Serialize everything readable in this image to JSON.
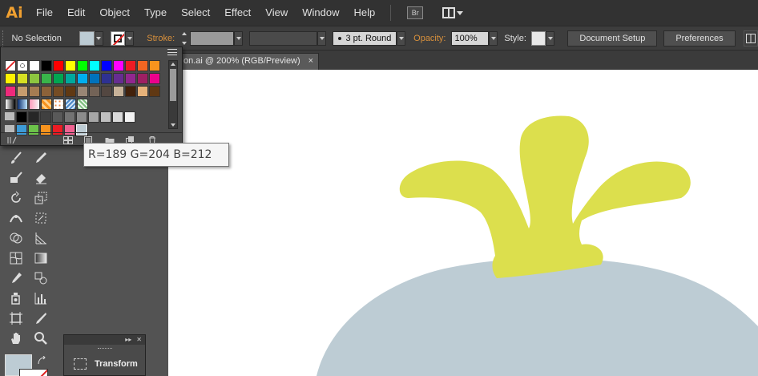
{
  "app": {
    "logo": "Ai"
  },
  "menu": {
    "items": [
      "File",
      "Edit",
      "Object",
      "Type",
      "Select",
      "Effect",
      "View",
      "Window",
      "Help"
    ],
    "bridge_label": "Br"
  },
  "control_bar": {
    "selection": "No Selection",
    "fill_color": "#bdccd4",
    "stroke_label": "Stroke:",
    "stroke_weight": "",
    "brush_profile": "3 pt. Round",
    "opacity_label": "Opacity:",
    "opacity_value": "100%",
    "style_label": "Style:",
    "document_setup": "Document Setup",
    "preferences": "Preferences"
  },
  "document": {
    "tab_title": "on.ai @ 200% (RGB/Preview)",
    "close": "×"
  },
  "swatch_panel": {
    "rows": [
      [
        "none",
        "registration",
        "#ffffff",
        "#000000",
        "#ff0000",
        "#ffff00",
        "#00ff00",
        "#00ffff",
        "#0000ff",
        "#ff00ff",
        "#ed1c24",
        "#f26522",
        "#f7941d"
      ],
      [
        "#fff200",
        "#d7df23",
        "#8dc63f",
        "#39b54a",
        "#00a651",
        "#00a99d",
        "#00aeef",
        "#0072bc",
        "#2e3192",
        "#662d91",
        "#92278f",
        "#9e1f63",
        "#ec008c"
      ],
      [
        "#ee2a7b",
        "#c69c6d",
        "#a67c52",
        "#8c6239",
        "#754c24",
        "#603913",
        "#998675",
        "#736357",
        "#534741",
        "#c7b299",
        "#42210b",
        "#e6b27a",
        "#603813"
      ],
      [
        "gradient-bw",
        "gradient-blue",
        "gradient-pink",
        "pattern-orange",
        "pattern-dots",
        "pattern-blue",
        "pattern-green"
      ],
      [
        "folder",
        "#000000",
        "#262626",
        "#404040",
        "#595959",
        "#737373",
        "#8c8c8c",
        "#a6a6a6",
        "#bfbfbf",
        "#d9d9d9",
        "#f2f2f2"
      ],
      [
        "folder",
        "#3d9bd7",
        "#6cc24a",
        "#f7931e",
        "#ec1c24",
        "#f06292",
        "#bdccd4"
      ]
    ]
  },
  "tooltip": {
    "text": "R=189 G=204 B=212"
  },
  "transform_panel": {
    "label": "Transform"
  },
  "artwork": {
    "body_color": "#bdccd4",
    "leaf_color": "#dcdf4d"
  }
}
